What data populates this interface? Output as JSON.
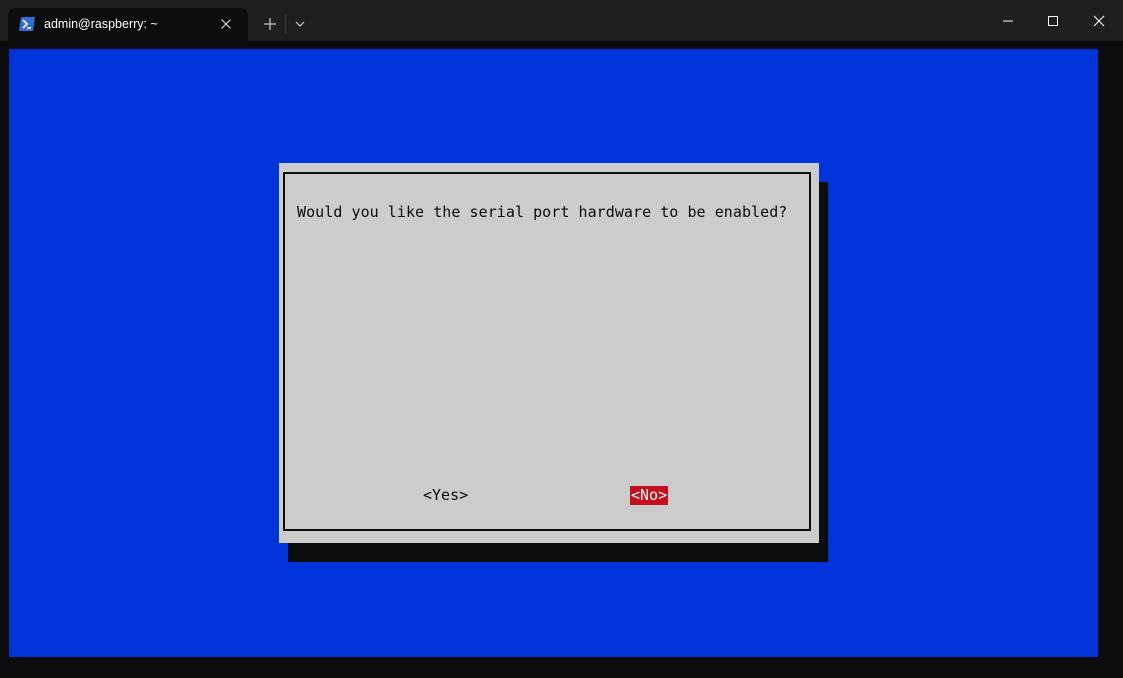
{
  "window": {
    "tab_title": "admin@raspberry: ~",
    "tab_icon": "powershell-icon",
    "new_tab_icon": "plus-icon",
    "dropdown_icon": "chevron-down-icon",
    "controls": [
      "minimize-icon",
      "maximize-icon",
      "close-icon"
    ]
  },
  "dialog": {
    "prompt": "Would you like the serial port hardware to be enabled?",
    "yes_label": "<Yes>",
    "no_label": "<No>",
    "selected": "<No>"
  },
  "colors": {
    "terminal_background": "#0034db",
    "dialog_background": "#cccccc",
    "selected_button": "#c50f1f",
    "titlebar": "#1f1f1f"
  }
}
